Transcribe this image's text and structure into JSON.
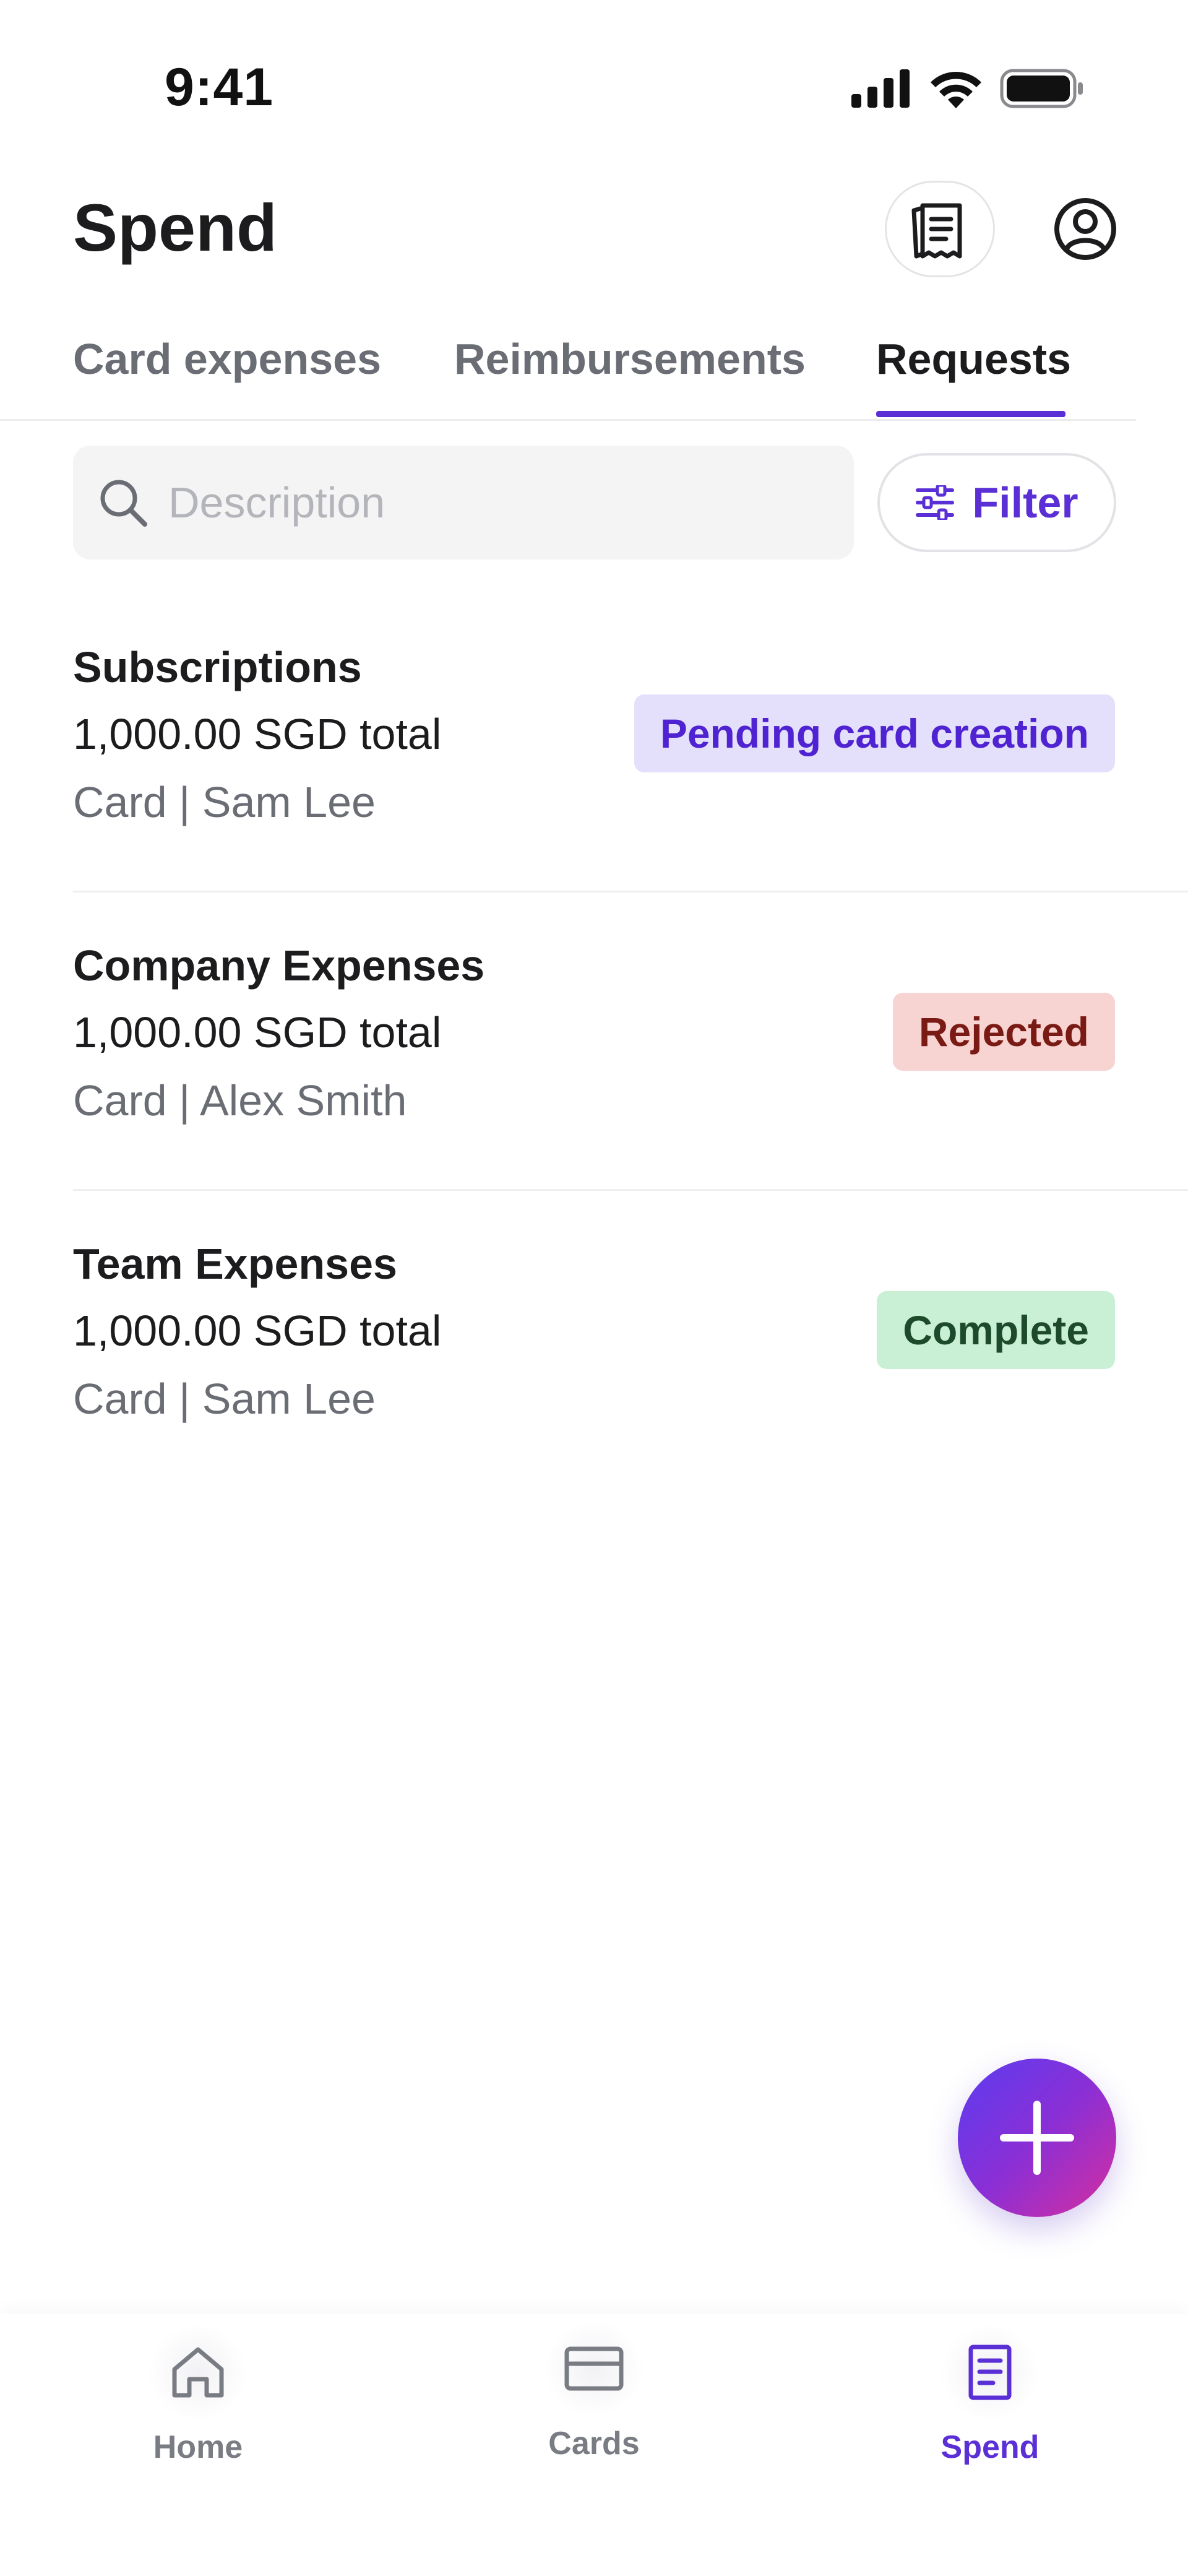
{
  "status_bar": {
    "time": "9:41",
    "icons": [
      "cellular-signal-icon",
      "wifi-icon",
      "battery-icon"
    ]
  },
  "header": {
    "title": "Spend",
    "receipt_icon": "receipt-icon",
    "profile_icon": "user-profile-icon"
  },
  "tabs": [
    {
      "label": "Card expenses",
      "active": false
    },
    {
      "label": "Reimbursements",
      "active": false
    },
    {
      "label": "Requests",
      "active": true
    }
  ],
  "search": {
    "placeholder": "Description",
    "value": ""
  },
  "filter": {
    "label": "Filter",
    "icon": "sliders-icon"
  },
  "requests": [
    {
      "title": "Subscriptions",
      "amount": "1,000.00 SGD total",
      "meta": "Card | Sam Lee",
      "status": "Pending card creation",
      "status_type": "pending"
    },
    {
      "title": "Company Expenses",
      "amount": "1,000.00 SGD total",
      "meta": "Card | Alex Smith",
      "status": "Rejected",
      "status_type": "rejected"
    },
    {
      "title": "Team Expenses",
      "amount": "1,000.00 SGD total",
      "meta": "Card | Sam Lee",
      "status": "Complete",
      "status_type": "complete"
    }
  ],
  "fab": {
    "icon": "plus-icon"
  },
  "bottom_nav": [
    {
      "label": "Home",
      "icon": "home-icon",
      "active": false
    },
    {
      "label": "Cards",
      "icon": "card-icon",
      "active": false
    },
    {
      "label": "Spend",
      "icon": "document-icon",
      "active": true
    }
  ],
  "colors": {
    "accent": "#5b2fd6",
    "pending_bg": "#e4e0fb",
    "rejected_bg": "#f7d3d2",
    "complete_bg": "#c9efd4"
  }
}
